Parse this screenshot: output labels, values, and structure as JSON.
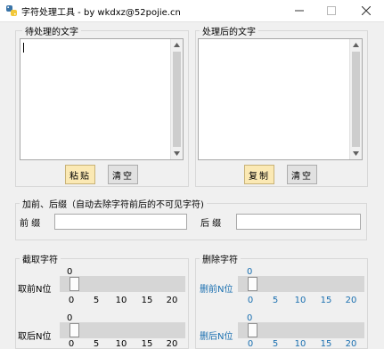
{
  "window": {
    "title": "字符处理工具 - by wkdxz@52pojie.cn"
  },
  "source_panel": {
    "label": "待处理的文字",
    "text": "",
    "paste_label": "粘贴",
    "clear_label": "清空"
  },
  "result_panel": {
    "label": "处理后的文字",
    "text": "",
    "copy_label": "复制",
    "clear_label": "清空"
  },
  "affix_panel": {
    "label": "加前、后缀（自动去除字符前后的不可见字符)",
    "prefix_label": "前 缀",
    "prefix_value": "",
    "suffix_label": "后 缀",
    "suffix_value": ""
  },
  "extract_panel": {
    "label": "截取字符",
    "front": {
      "label": "取前N位",
      "value": "0",
      "ticks": [
        "0",
        "5",
        "10",
        "15",
        "20"
      ]
    },
    "back": {
      "label": "取后N位",
      "value": "0",
      "ticks": [
        "0",
        "5",
        "10",
        "15",
        "20"
      ]
    }
  },
  "delete_panel": {
    "label": "删除字符",
    "front": {
      "label": "删前N位",
      "value": "0",
      "ticks": [
        "0",
        "5",
        "10",
        "15",
        "20"
      ]
    },
    "back": {
      "label": "删后N位",
      "value": "0",
      "ticks": [
        "0",
        "5",
        "10",
        "15",
        "20"
      ]
    }
  },
  "colors": {
    "accent_blue": "#1a6fb0",
    "primary_button": "#fbe9b4",
    "window_bg": "#f0f0f0"
  }
}
